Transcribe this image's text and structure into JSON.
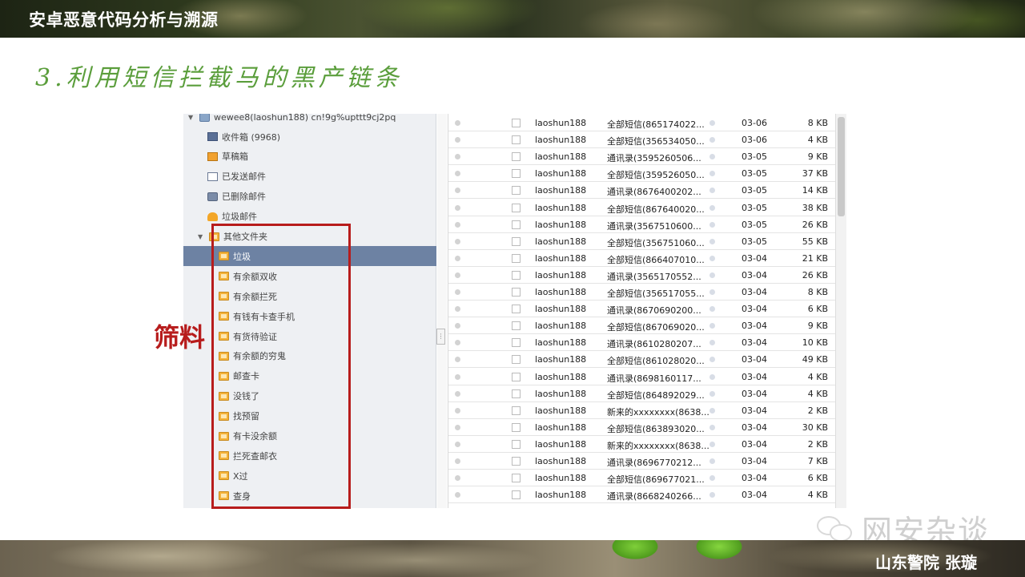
{
  "header": {
    "title": "安卓恶意代码分析与溯源"
  },
  "slide": {
    "subtitle": "3.利用短信拦截马的黑产链条"
  },
  "folders": {
    "account": "wewee8(laoshun188)  cn!9g%upttt9cj2pq",
    "items": [
      {
        "label": "收件箱 (9968)",
        "icon": "inbox-icon"
      },
      {
        "label": "草稿箱",
        "icon": "draft-icon"
      },
      {
        "label": "已发送邮件",
        "icon": "sent-icon"
      },
      {
        "label": "已删除邮件",
        "icon": "deleted-icon"
      },
      {
        "label": "垃圾邮件",
        "icon": "junk-icon"
      },
      {
        "label": "其他文件夹",
        "icon": "folder-icon"
      },
      {
        "label": "垃圾",
        "icon": "folder-icon"
      },
      {
        "label": "有余额双收",
        "icon": "folder-icon"
      },
      {
        "label": "有余额拦死",
        "icon": "folder-icon"
      },
      {
        "label": "有钱有卡查手机",
        "icon": "folder-icon"
      },
      {
        "label": "有货待验证",
        "icon": "folder-icon"
      },
      {
        "label": "有余额的穷鬼",
        "icon": "folder-icon"
      },
      {
        "label": "邮查卡",
        "icon": "folder-icon"
      },
      {
        "label": "没钱了",
        "icon": "folder-icon"
      },
      {
        "label": "找预留",
        "icon": "folder-icon"
      },
      {
        "label": "有卡没余额",
        "icon": "folder-icon"
      },
      {
        "label": "拦死查邮衣",
        "icon": "folder-icon"
      },
      {
        "label": "X过",
        "icon": "folder-icon"
      },
      {
        "label": "查身",
        "icon": "folder-icon"
      }
    ]
  },
  "mails": [
    {
      "sender": "laoshun188",
      "subject": "全部短信(865174022...",
      "date": "03-06",
      "size": "8 KB"
    },
    {
      "sender": "laoshun188",
      "subject": "全部短信(356534050...",
      "date": "03-06",
      "size": "4 KB"
    },
    {
      "sender": "laoshun188",
      "subject": "通讯录(3595260506...",
      "date": "03-05",
      "size": "9 KB"
    },
    {
      "sender": "laoshun188",
      "subject": "全部短信(359526050...",
      "date": "03-05",
      "size": "37 KB"
    },
    {
      "sender": "laoshun188",
      "subject": "通讯录(8676400202...",
      "date": "03-05",
      "size": "14 KB"
    },
    {
      "sender": "laoshun188",
      "subject": "全部短信(867640020...",
      "date": "03-05",
      "size": "38 KB"
    },
    {
      "sender": "laoshun188",
      "subject": "通讯录(3567510600...",
      "date": "03-05",
      "size": "26 KB"
    },
    {
      "sender": "laoshun188",
      "subject": "全部短信(356751060...",
      "date": "03-05",
      "size": "55 KB"
    },
    {
      "sender": "laoshun188",
      "subject": "全部短信(866407010...",
      "date": "03-04",
      "size": "21 KB"
    },
    {
      "sender": "laoshun188",
      "subject": "通讯录(3565170552...",
      "date": "03-04",
      "size": "26 KB"
    },
    {
      "sender": "laoshun188",
      "subject": "全部短信(356517055...",
      "date": "03-04",
      "size": "8 KB"
    },
    {
      "sender": "laoshun188",
      "subject": "通讯录(8670690200...",
      "date": "03-04",
      "size": "6 KB"
    },
    {
      "sender": "laoshun188",
      "subject": "全部短信(867069020...",
      "date": "03-04",
      "size": "9 KB"
    },
    {
      "sender": "laoshun188",
      "subject": "通讯录(8610280207...",
      "date": "03-04",
      "size": "10 KB"
    },
    {
      "sender": "laoshun188",
      "subject": "全部短信(861028020...",
      "date": "03-04",
      "size": "49 KB"
    },
    {
      "sender": "laoshun188",
      "subject": "通讯录(8698160117...",
      "date": "03-04",
      "size": "4 KB"
    },
    {
      "sender": "laoshun188",
      "subject": "全部短信(864892029...",
      "date": "03-04",
      "size": "4 KB"
    },
    {
      "sender": "laoshun188",
      "subject": "新来的xxxxxxxx(8638...",
      "date": "03-04",
      "size": "2 KB"
    },
    {
      "sender": "laoshun188",
      "subject": "全部短信(863893020...",
      "date": "03-04",
      "size": "30 KB"
    },
    {
      "sender": "laoshun188",
      "subject": "新来的xxxxxxxx(8638...",
      "date": "03-04",
      "size": "2 KB"
    },
    {
      "sender": "laoshun188",
      "subject": "通讯录(8696770212...",
      "date": "03-04",
      "size": "7 KB"
    },
    {
      "sender": "laoshun188",
      "subject": "全部短信(869677021...",
      "date": "03-04",
      "size": "6 KB"
    },
    {
      "sender": "laoshun188",
      "subject": "通讯录(8668240266...",
      "date": "03-04",
      "size": "4 KB"
    }
  ],
  "callout": {
    "label": "筛料"
  },
  "watermark": {
    "text": "网安杂谈"
  },
  "footer": {
    "author": "山东警院  张璇"
  },
  "colors": {
    "accent_green": "#5b9e3c",
    "annotation_red": "#b71c1c",
    "selected_folder": "#6d82a3"
  }
}
